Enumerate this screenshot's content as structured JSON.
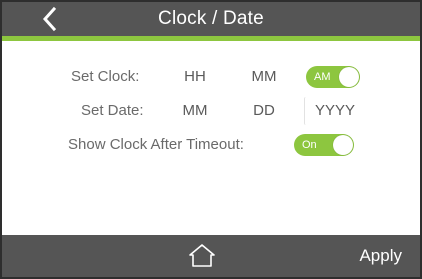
{
  "header": {
    "title": "Clock / Date",
    "back_icon": "chevron-left-icon"
  },
  "form": {
    "set_clock": {
      "label": "Set Clock:",
      "hour_placeholder": "HH",
      "minute_placeholder": "MM",
      "ampm_toggle": {
        "label": "AM",
        "state": "on"
      }
    },
    "set_date": {
      "label": "Set Date:",
      "month_placeholder": "MM",
      "day_placeholder": "DD",
      "year_placeholder": "YYYY"
    },
    "show_clock": {
      "label": "Show Clock After Timeout:",
      "toggle": {
        "label": "On",
        "state": "on"
      }
    }
  },
  "footer": {
    "home_icon": "home-icon",
    "apply_label": "Apply"
  },
  "colors": {
    "header_bg": "#555555",
    "accent_green": "#8dc63f",
    "footer_bg": "#555555",
    "label_text": "#6a6a6a"
  }
}
